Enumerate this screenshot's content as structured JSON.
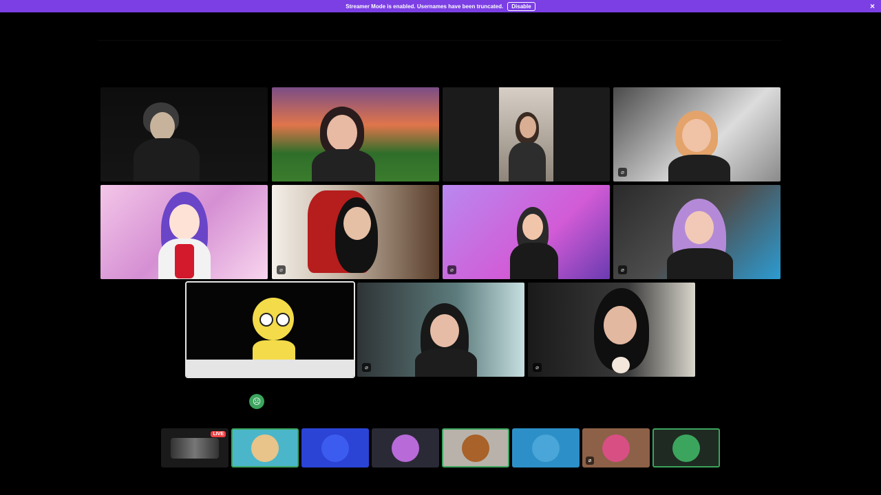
{
  "banner": {
    "message": "Streamer Mode is enabled. Usernames have been truncated.",
    "disable_label": "Disable",
    "close_icon": "×"
  },
  "tiles": [
    {
      "id": "t1",
      "muted": false,
      "speaking": false
    },
    {
      "id": "t2",
      "muted": false,
      "speaking": false
    },
    {
      "id": "t3",
      "muted": false,
      "speaking": false
    },
    {
      "id": "t4",
      "muted": true,
      "speaking": false
    },
    {
      "id": "t5",
      "muted": false,
      "speaking": false
    },
    {
      "id": "t6",
      "muted": true,
      "speaking": false
    },
    {
      "id": "t7",
      "muted": true,
      "speaking": false
    },
    {
      "id": "t8",
      "muted": true,
      "speaking": false
    },
    {
      "id": "t9",
      "muted": false,
      "speaking": true
    },
    {
      "id": "t10",
      "muted": true,
      "speaking": false
    },
    {
      "id": "t11",
      "muted": true,
      "speaking": false
    }
  ],
  "mute_icon": "⌀",
  "bottom_bar": {
    "live_label": "LIVE",
    "thumbs": [
      {
        "id": "b1",
        "bg": "#1a1a1a",
        "avatar": "#666",
        "active": false,
        "live": true
      },
      {
        "id": "b2",
        "bg": "#4bb6c9",
        "avatar": "#e8c48a",
        "active": true,
        "live": false
      },
      {
        "id": "b3",
        "bg": "#2b44d6",
        "avatar": "#3c5cf0",
        "active": false,
        "live": false
      },
      {
        "id": "b4",
        "bg": "#2a2a36",
        "avatar": "#b86ad8",
        "active": false,
        "live": false
      },
      {
        "id": "b5",
        "bg": "#b9b2ab",
        "avatar": "#a8622a",
        "active": true,
        "live": false
      },
      {
        "id": "b6",
        "bg": "#2c8fc7",
        "avatar": "#4aa6d8",
        "active": false,
        "live": false
      },
      {
        "id": "b7",
        "bg": "#8c6148",
        "avatar": "#d74f83",
        "active": false,
        "live": false,
        "muted": true
      },
      {
        "id": "b8",
        "bg": "#1f2a22",
        "avatar": "#3ba55d",
        "active": true,
        "live": false
      }
    ]
  },
  "reaction_emoji": "☹"
}
